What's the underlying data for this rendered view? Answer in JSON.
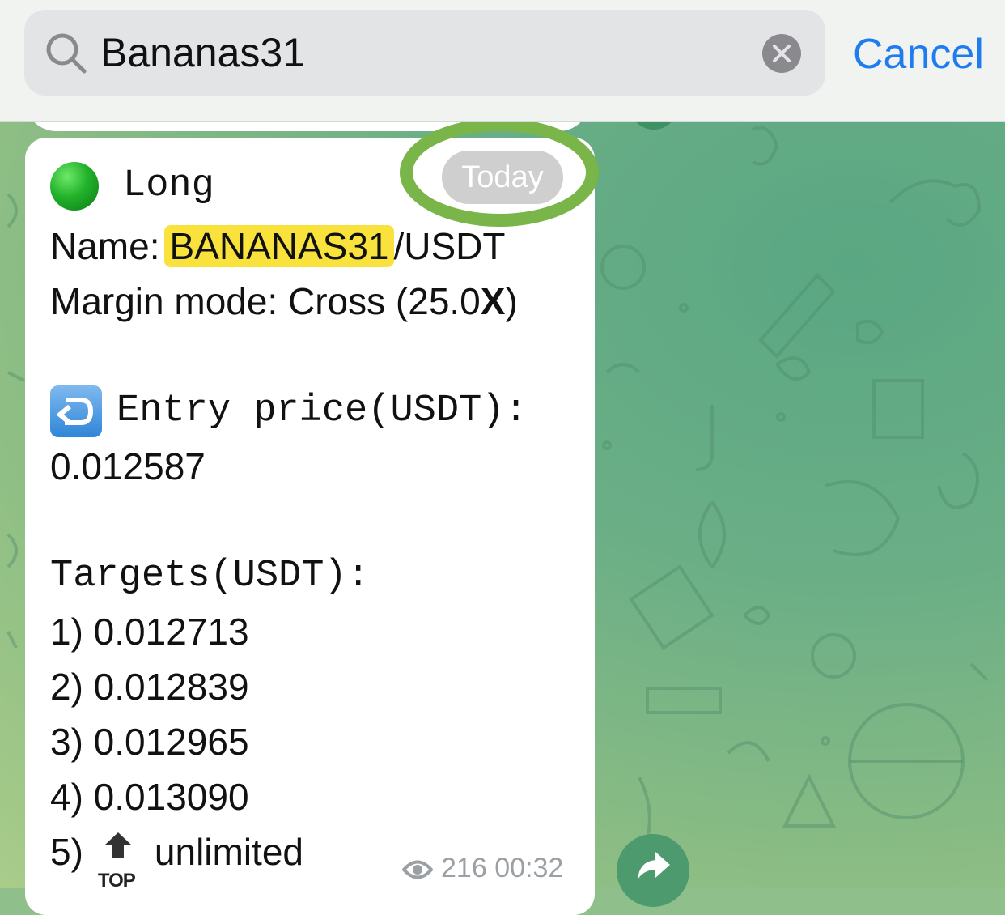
{
  "search": {
    "query": "Bananas31",
    "cancel_label": "Cancel"
  },
  "message": {
    "direction": "Long",
    "name_label": "Name:",
    "name_highlight": "BANANAS31",
    "name_rest": "/USDT",
    "margin_prefix": "Margin mode: Cross (25.0",
    "margin_x": "X",
    "margin_suffix": ")",
    "entry_label": "Entry price(USDT):",
    "entry_value": "0.012587",
    "targets_label": "Targets(USDT):",
    "targets": [
      "1) 0.012713",
      "2) 0.012839",
      "3) 0.012965",
      "4) 0.013090"
    ],
    "target5_prefix": "5)",
    "target5_icon_text": "TOP",
    "target5_value": "unlimited",
    "views": "216",
    "time": "00:32"
  },
  "date_badge": "Today",
  "colors": {
    "accent": "#1e7cf0",
    "highlight": "#f9e23c",
    "annotation_circle": "#79b548",
    "status_dot": "#22b22a"
  },
  "icons": [
    "search-icon",
    "clear-icon",
    "entry-arrow-icon",
    "top-arrow-icon",
    "eye-icon",
    "forward-icon"
  ]
}
